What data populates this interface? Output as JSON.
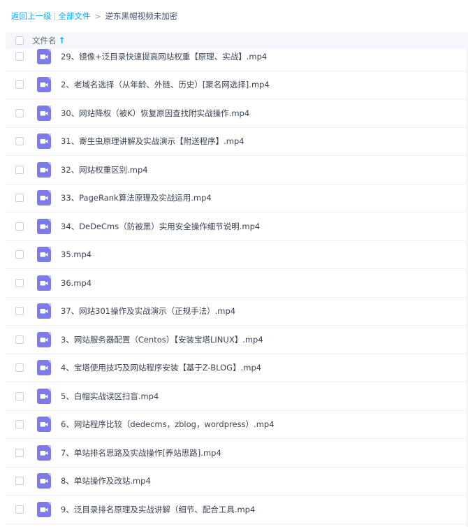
{
  "breadcrumb": {
    "back": "返回上一级",
    "separator": "|",
    "all_files": "全部文件",
    "chevron": ">",
    "current": "逆东黑帽视频未加密"
  },
  "header": {
    "filename_label": "文件名",
    "sort_arrow": "↑"
  },
  "files": [
    "29、镜像+泛目录快速提高网站权重【原理、实战】.mp4",
    "2、老域名选择（从年龄、外链、历史）[聚名网选择].mp4",
    "30、网站降权（被K）恢复原因查找附实战操作.mp4",
    "31、寄生虫原理讲解及实战演示【附送程序】.mp4",
    "32、网站权重区别.mp4",
    "33、PageRank算法原理及实战运用.mp4",
    "34、DeDeCms（防被黑）实用安全操作细节说明.mp4",
    "35.mp4",
    "36.mp4",
    "37、网站301操作及实战演示（正规手法）.mp4",
    "3、网站服务器配置（Centos）【安装宝塔LINUX】.mp4",
    "4、宝塔使用技巧及网站程序安装【基于Z-BLOG】.mp4",
    "5、白帽实战误区扫盲.mp4",
    "6、网站程序比较（dedecms，zblog，wordpress）.mp4",
    "7、单站排名思路及实战操作[养站思路].mp4",
    "8、单站操作及改站.mp4",
    "9、泛目录排名原理及实战讲解（细节、配合工具.mp4"
  ],
  "icons": {
    "file_icon": "video-file-icon",
    "file_icon_color": "#7e7ae8",
    "accent": "#09aaff"
  }
}
